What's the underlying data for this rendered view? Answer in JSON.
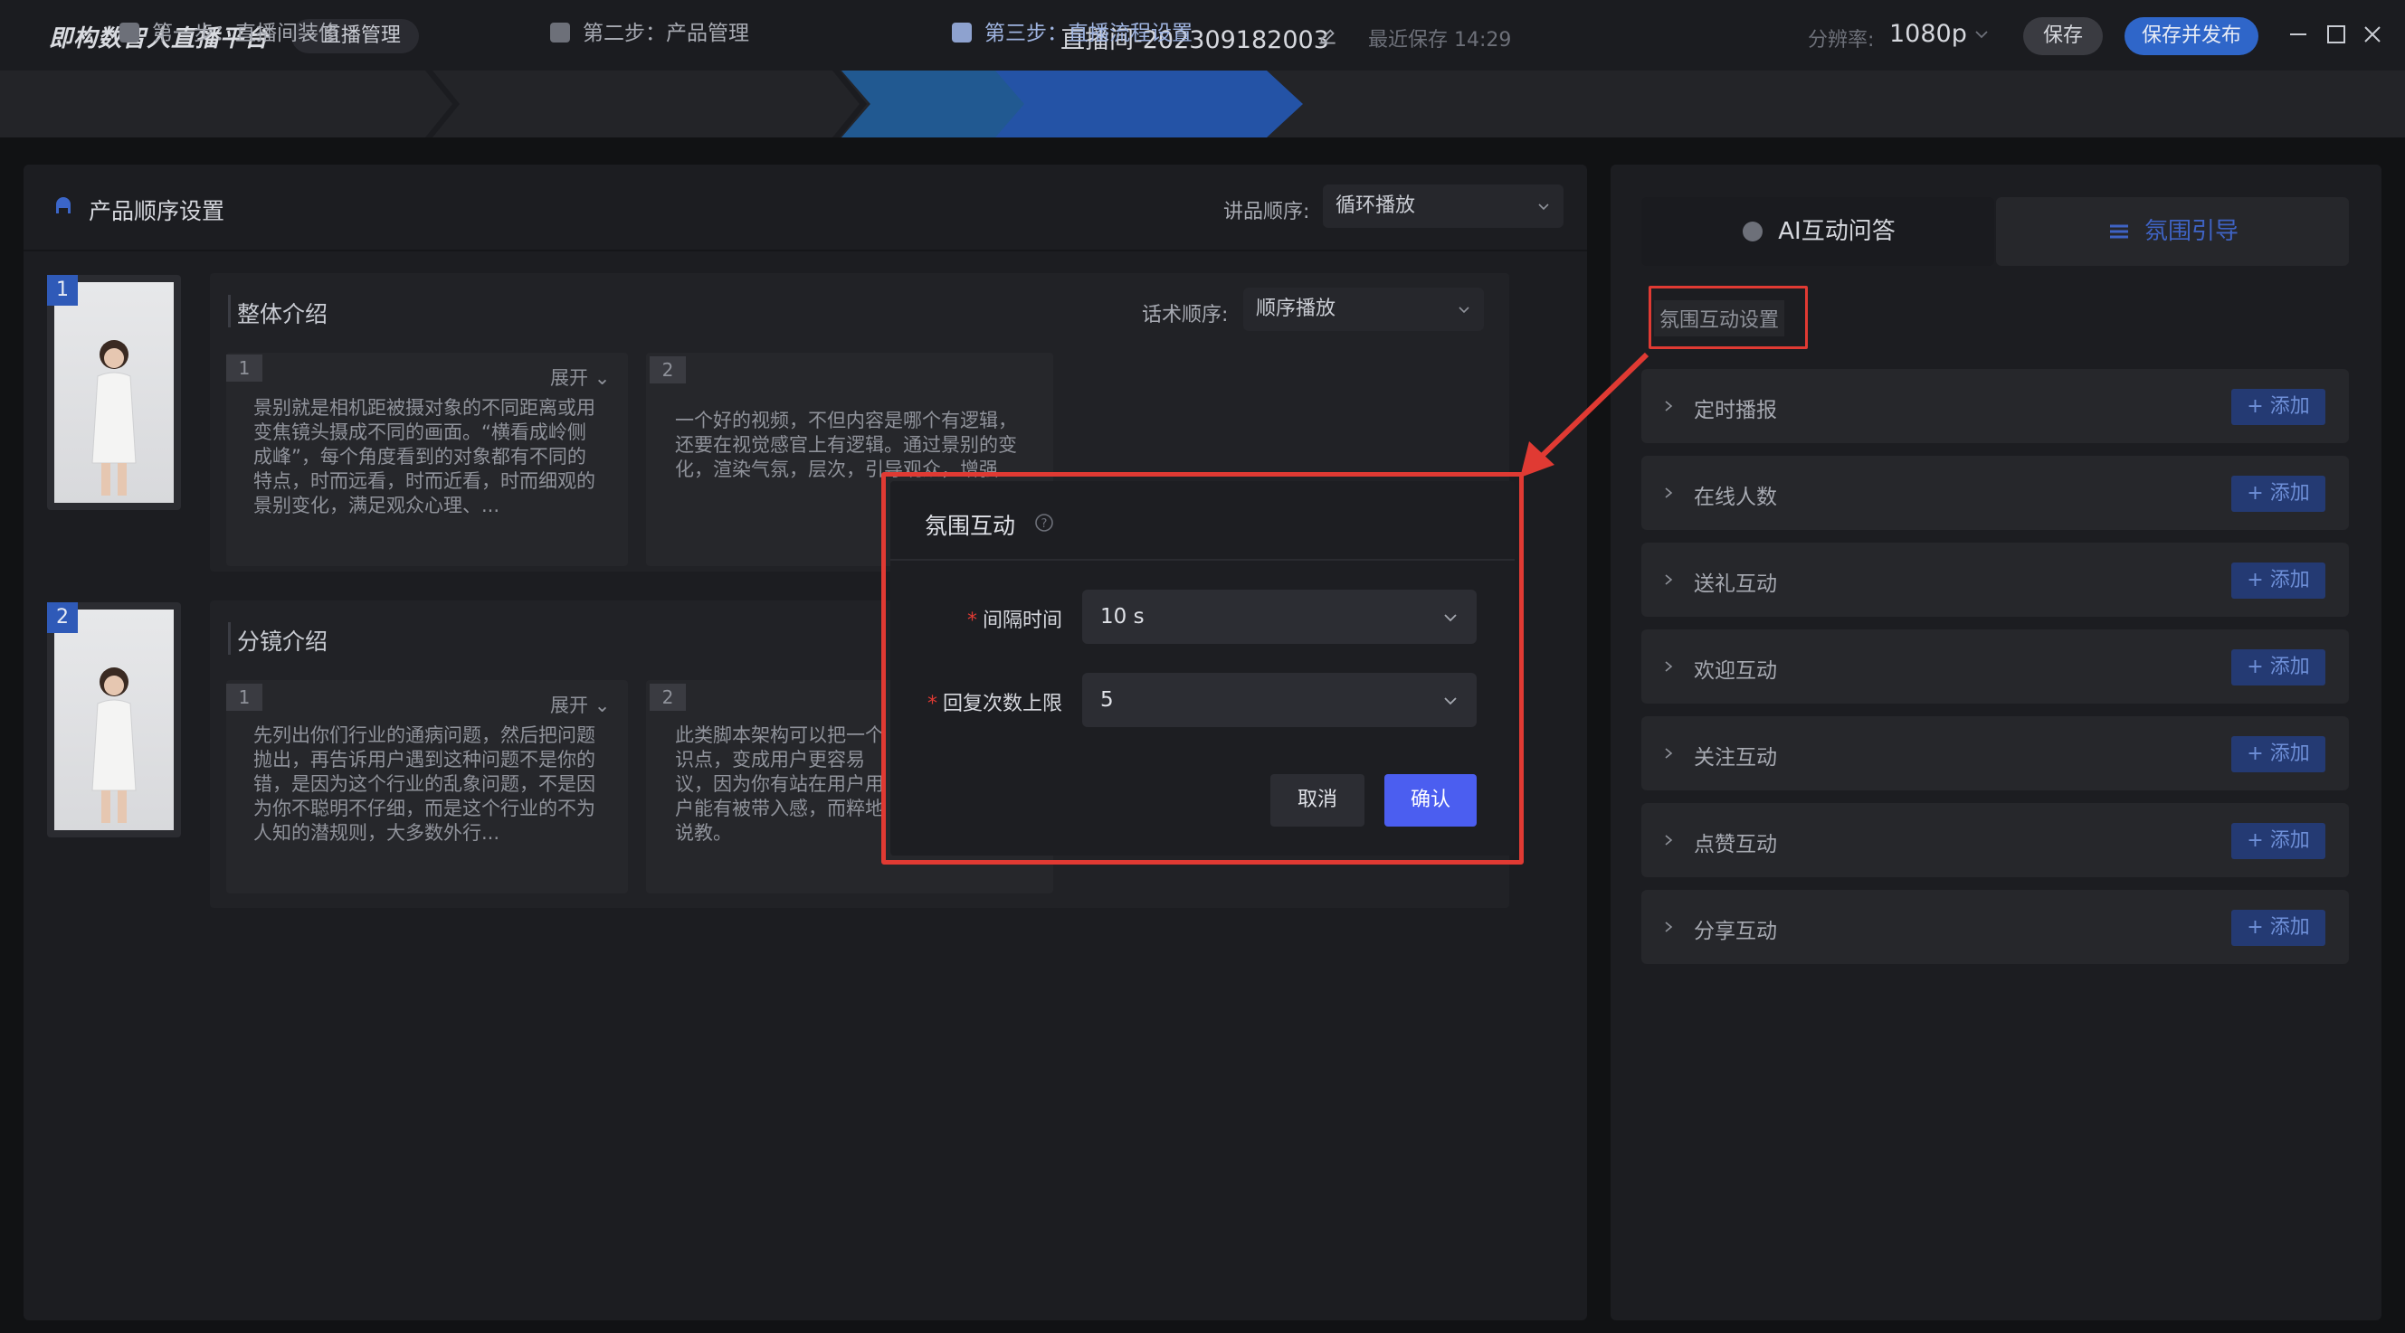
{
  "app": {
    "logo": "即构数智人直播平台",
    "back_label": "直播管理",
    "room_title": "直播间-202309182003",
    "last_saved": "最近保存 14:29",
    "resolution_label": "分辨率:",
    "resolution_value": "1080p",
    "save_label": "保存",
    "publish_label": "保存并发布"
  },
  "steps": [
    {
      "label": "第一步：直播间装修"
    },
    {
      "label": "第二步：产品管理"
    },
    {
      "label": "第三步：直播流程设置"
    }
  ],
  "left_panel": {
    "title": "产品顺序设置",
    "order_label": "讲品顺序:",
    "order_value": "循环播放",
    "products": [
      {
        "badge": "1",
        "section_title": "整体介绍",
        "script_order_label": "话术顺序:",
        "script_order_value": "顺序播放",
        "cards": [
          {
            "num": "1",
            "expand": "展开",
            "text": "景别就是相机距被摄对象的不同距离或用变焦镜头摄成不同的画面。“横看成岭侧成峰”，每个角度看到的对象都有不同的特点，时而远看，时而近看，时而细观的景别变化，满足观众心理、..."
          },
          {
            "num": "2",
            "text": "一个好的视频，不但内容是哪个有逻辑，还要在视觉感官上有逻辑。通过景别的变化，渲染气氛，层次，引导观众，增强"
          }
        ]
      },
      {
        "badge": "2",
        "section_title": "分镜介绍",
        "cards": [
          {
            "num": "1",
            "expand": "展开",
            "text": "先列出你们行业的通病问题，然后把问题抛出，再告诉用户遇到这种问题不是你的错，是因为这个行业的乱象问题，不是因为你不聪明不仔细，而是这个行业的不为人知的潜规则，大多数外行..."
          },
          {
            "num": "2",
            "text": "此类脚本架构可以把一个识点，变成用户更容易议，因为你有站在用户用户能有被带入感，而粹地说教。"
          }
        ]
      }
    ]
  },
  "right_panel": {
    "tabs": [
      {
        "label": "AI互动问答"
      },
      {
        "label": "氛围引导"
      }
    ],
    "settings_label": "氛围互动设置",
    "add_label": "+ 添加",
    "rows": [
      {
        "label": "定时播报"
      },
      {
        "label": "在线人数"
      },
      {
        "label": "送礼互动"
      },
      {
        "label": "欢迎互动"
      },
      {
        "label": "关注互动"
      },
      {
        "label": "点赞互动"
      },
      {
        "label": "分享互动"
      }
    ]
  },
  "modal": {
    "title": "氛围互动",
    "fields": [
      {
        "label": "间隔时间",
        "value": "10 s"
      },
      {
        "label": "回复次数上限",
        "value": "5"
      }
    ],
    "cancel_label": "取消",
    "confirm_label": "确认"
  },
  "colors": {
    "accent": "#4b5ef0",
    "highlight": "#e03a33",
    "publish": "#2f66c9",
    "active_step": "#2453a6"
  }
}
